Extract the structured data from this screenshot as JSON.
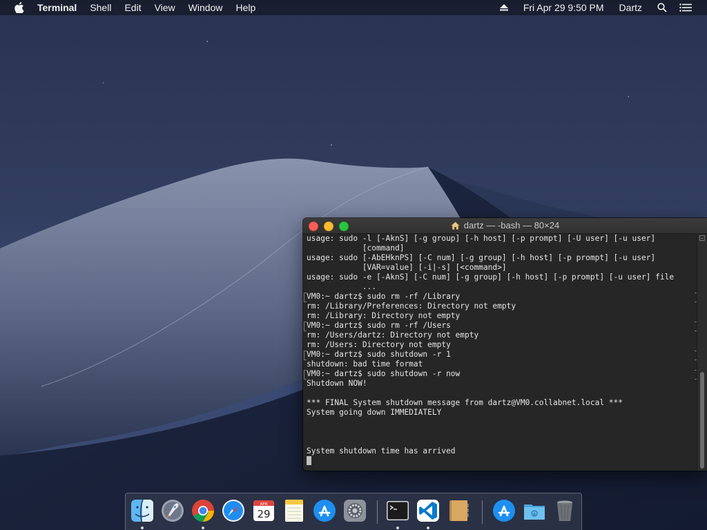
{
  "menubar": {
    "app_name": "Terminal",
    "menus": [
      "Shell",
      "Edit",
      "View",
      "Window",
      "Help"
    ],
    "datetime": "Fri Apr 29  9:50 PM",
    "user": "Dartz"
  },
  "terminal": {
    "title": "dartz — -bash — 80×24",
    "lines": [
      {
        "text": "usage: sudo -l [-AknS] [-g group] [-h host] [-p prompt] [-U user] [-u user]",
        "marked": false
      },
      {
        "text": "            [command]",
        "marked": false
      },
      {
        "text": "usage: sudo [-AbEHknPS] [-C num] [-g group] [-h host] [-p prompt] [-u user]",
        "marked": false
      },
      {
        "text": "            [VAR=value] [-i|-s] [<command>]",
        "marked": false
      },
      {
        "text": "usage: sudo -e [-AknS] [-C num] [-g group] [-h host] [-p prompt] [-u user] file",
        "marked": false
      },
      {
        "text": "            ...",
        "marked": false
      },
      {
        "text": "VM0:~ dartz$ sudo rm -rf /Library",
        "marked": true
      },
      {
        "text": "rm: /Library/Preferences: Directory not empty",
        "marked": false
      },
      {
        "text": "rm: /Library: Directory not empty",
        "marked": false
      },
      {
        "text": "VM0:~ dartz$ sudo rm -rf /Users",
        "marked": true
      },
      {
        "text": "rm: /Users/dartz: Directory not empty",
        "marked": false
      },
      {
        "text": "rm: /Users: Directory not empty",
        "marked": false
      },
      {
        "text": "VM0:~ dartz$ sudo shutdown -r 1",
        "marked": true
      },
      {
        "text": "shutdown: bad time format",
        "marked": false
      },
      {
        "text": "VM0:~ dartz$ sudo shutdown -r now",
        "marked": true
      },
      {
        "text": "Shutdown NOW!",
        "marked": false
      },
      {
        "text": "",
        "marked": false
      },
      {
        "text": "*** FINAL System shutdown message from dartz@VM0.collabnet.local ***",
        "marked": false
      },
      {
        "text": "System going down IMMEDIATELY",
        "marked": false
      },
      {
        "text": "",
        "marked": false
      },
      {
        "text": "",
        "marked": false
      },
      {
        "text": "",
        "marked": false
      },
      {
        "text": "System shutdown time has arrived",
        "marked": false
      }
    ]
  },
  "dock": {
    "calendar": {
      "month": "APR",
      "day": "29"
    },
    "items": [
      {
        "name": "finder-icon",
        "running": true
      },
      {
        "name": "launchpad-icon",
        "running": false
      },
      {
        "name": "chrome-icon",
        "running": true
      },
      {
        "name": "safari-icon",
        "running": false
      },
      {
        "name": "calendar-icon",
        "running": false
      },
      {
        "name": "notes-icon",
        "running": false
      },
      {
        "name": "app-store-icon",
        "running": false
      },
      {
        "name": "system-preferences-icon",
        "running": false
      },
      {
        "name": "terminal-icon",
        "running": true
      },
      {
        "name": "vscode-icon",
        "running": true
      },
      {
        "name": "contacts-icon",
        "running": false
      },
      {
        "name": "app-store-downloads-icon",
        "running": false
      },
      {
        "name": "downloads-folder-icon",
        "running": false
      },
      {
        "name": "trash-icon",
        "running": false
      }
    ]
  }
}
